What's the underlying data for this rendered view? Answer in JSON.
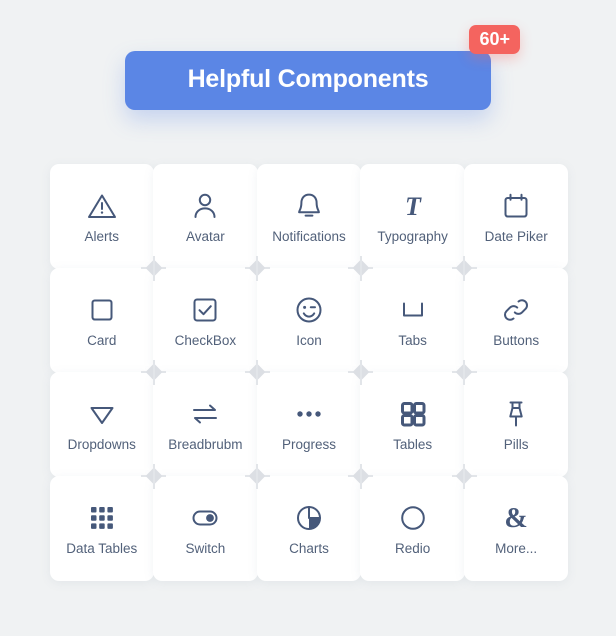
{
  "header": {
    "title": "Helpful Components",
    "badge": "60+",
    "banner_color": "#5b86e5",
    "badge_color": "#f4645f"
  },
  "theme": {
    "background": "#f0f2f3",
    "card_background": "#ffffff",
    "icon_color": "#46587a",
    "label_color": "#52617a",
    "grid_marker_color": "#e2e5e9"
  },
  "grid": {
    "columns": 5,
    "rows": 4,
    "items": [
      {
        "label": "Alerts",
        "icon": "warning-triangle-icon"
      },
      {
        "label": "Avatar",
        "icon": "person-icon"
      },
      {
        "label": "Notifications",
        "icon": "bell-icon"
      },
      {
        "label": "Typography",
        "icon": "italic-t-icon"
      },
      {
        "label": "Date Piker",
        "icon": "calendar-icon"
      },
      {
        "label": "Card",
        "icon": "square-outline-icon"
      },
      {
        "label": "CheckBox",
        "icon": "checked-box-icon"
      },
      {
        "label": "Icon",
        "icon": "winking-smiley-icon"
      },
      {
        "label": "Tabs",
        "icon": "u-bracket-icon"
      },
      {
        "label": "Buttons",
        "icon": "chain-link-icon"
      },
      {
        "label": "Dropdowns",
        "icon": "triangle-down-icon"
      },
      {
        "label": "Breadbrubm",
        "icon": "two-way-arrows-icon"
      },
      {
        "label": "Progress",
        "icon": "three-dots-icon"
      },
      {
        "label": "Tables",
        "icon": "four-squares-icon"
      },
      {
        "label": "Pills",
        "icon": "pushpin-icon"
      },
      {
        "label": "Data Tables",
        "icon": "nine-dots-grid-icon"
      },
      {
        "label": "Switch",
        "icon": "toggle-switch-icon"
      },
      {
        "label": "Charts",
        "icon": "pie-chart-icon"
      },
      {
        "label": "Redio",
        "icon": "circle-outline-icon"
      },
      {
        "label": "More...",
        "icon": "ampersand-icon"
      }
    ]
  }
}
